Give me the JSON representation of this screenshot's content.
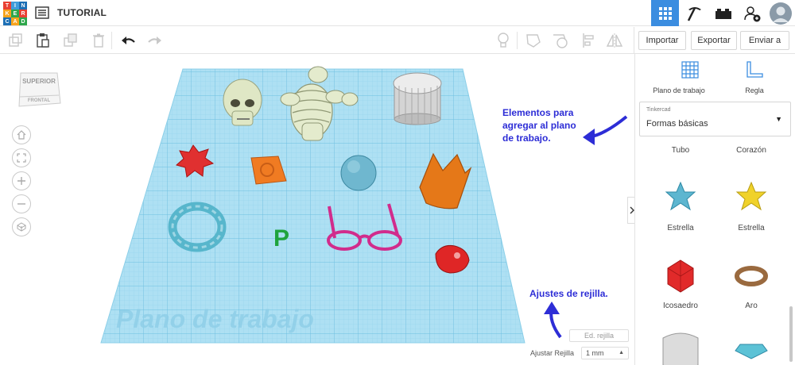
{
  "app": {
    "logo_letters": [
      "T",
      "I",
      "N",
      "K",
      "E",
      "R",
      "C",
      "A",
      "D"
    ],
    "title": "TUTORIAL"
  },
  "topbar": {
    "icons": [
      "grid-view-icon",
      "pickaxe-icon",
      "bricks-icon",
      "add-user-icon",
      "avatar"
    ]
  },
  "toolbar": {
    "icons": [
      "copy-icon",
      "paste-icon",
      "duplicate-icon",
      "delete-icon",
      "undo-icon",
      "redo-icon",
      "light-bulb-icon",
      "shape-icon",
      "hole-icon",
      "align-icon",
      "mirror-icon"
    ],
    "import_label": "Importar",
    "export_label": "Exportar",
    "send_label": "Enviar a"
  },
  "viewcube": {
    "top": "SUPERIOR",
    "front": "FRONTAL"
  },
  "workplane": {
    "watermark": "Plano de trabajo"
  },
  "annotations": {
    "elements_line1": "Elementos para",
    "elements_line2": "agregar al plano",
    "elements_line3": "de trabajo.",
    "grid": "Ajustes de rejilla."
  },
  "grid_settings": {
    "edit_label": "Ed. rejilla",
    "snap_label": "Ajustar Rejilla",
    "snap_value": "1 mm"
  },
  "panel": {
    "workplane_label": "Plano de trabajo",
    "ruler_label": "Regla",
    "library_caption": "Tinkercad",
    "library_value": "Formas básicas",
    "shapes": [
      {
        "label": "Tubo"
      },
      {
        "label": "Corazón"
      },
      {
        "label": "Estrella"
      },
      {
        "label": "Estrella"
      },
      {
        "label": "Icosaedro"
      },
      {
        "label": "Aro"
      }
    ]
  },
  "colors": {
    "accent": "#3b8de0",
    "grid": "#a7dcf0",
    "annotation": "#2d2dd6",
    "green_text": "#1fa33d"
  }
}
